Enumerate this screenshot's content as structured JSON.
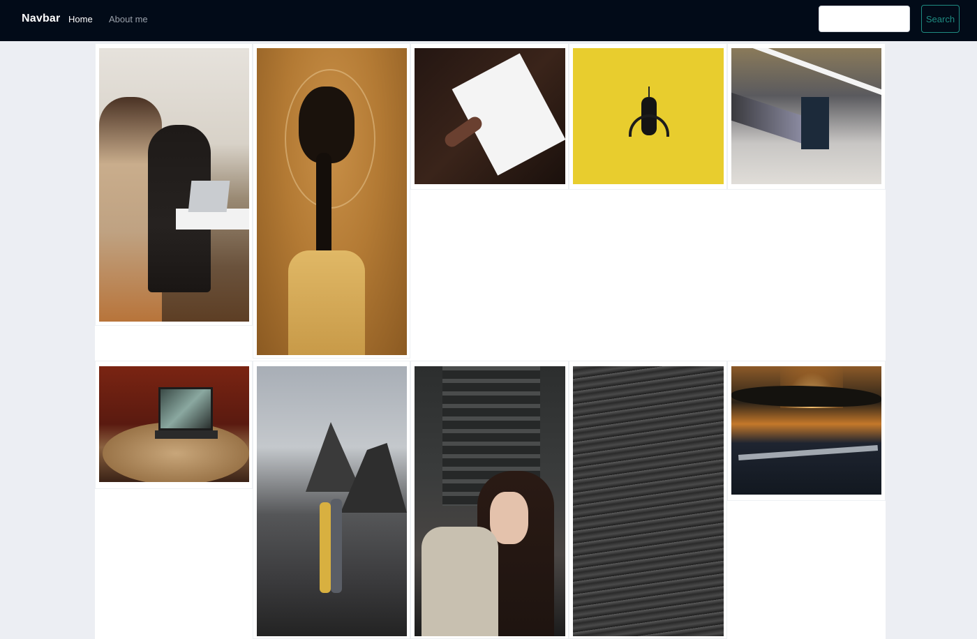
{
  "navbar": {
    "brand": "Navbar",
    "links": [
      {
        "label": "Home"
      },
      {
        "label": "About me"
      }
    ],
    "search": {
      "placeholder": "",
      "button_label": "Search"
    }
  },
  "colors": {
    "navbar_bg": "#020b18",
    "search_accent": "#1f8c82",
    "page_bg": "#eceef3"
  },
  "gallery": {
    "photos": [
      {
        "subject": "two people working at a laptop"
      },
      {
        "subject": "woman with braid and glass halo on ochre background"
      },
      {
        "subject": "hand writing in a spiral notebook"
      },
      {
        "subject": "small black robot on yellow background"
      },
      {
        "subject": "subway train motion blur"
      },
      {
        "subject": "laptop on a round wooden table"
      },
      {
        "subject": "couple embracing on rocky sea coast"
      },
      {
        "subject": "woman shielding eyes near stairs"
      },
      {
        "subject": "dark ocean waves"
      },
      {
        "subject": "sunset rays over sea"
      }
    ]
  }
}
